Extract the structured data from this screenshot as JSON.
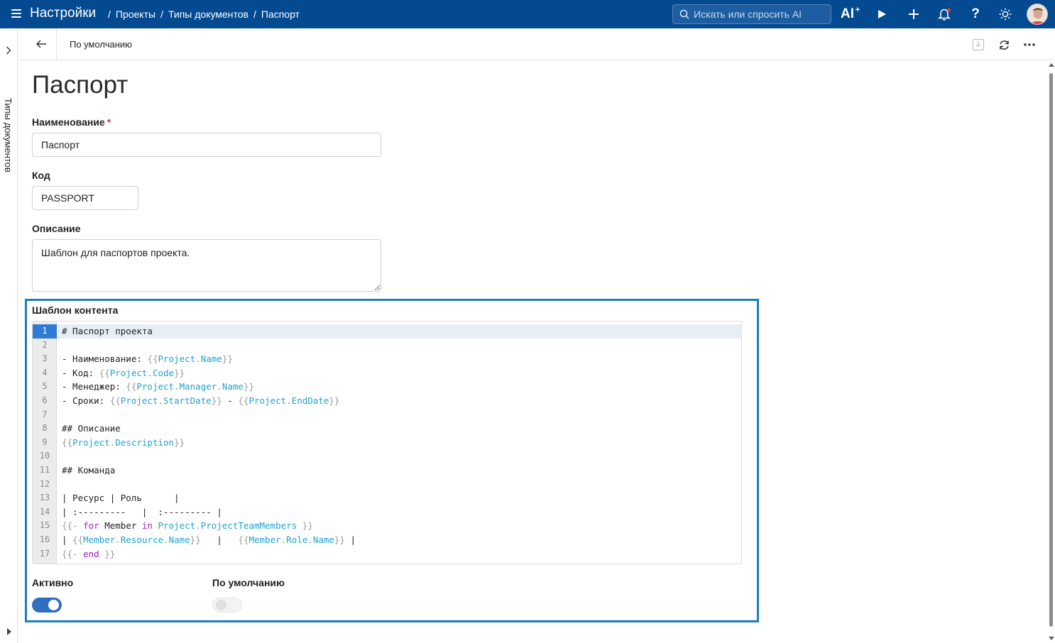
{
  "topbar": {
    "app_title": "Настройки",
    "breadcrumb": [
      "Проекты",
      "Типы документов",
      "Паспорт"
    ],
    "search_placeholder": "Искать или спросить AI",
    "ai_label": "AI",
    "bg_color": "#034a91"
  },
  "left_rail": {
    "label": "Типы документов"
  },
  "subheader": {
    "title": "По умолчанию"
  },
  "page": {
    "title": "Паспорт",
    "fields": {
      "name": {
        "label": "Наименование",
        "required_mark": "*",
        "value": "Паспорт"
      },
      "code": {
        "label": "Код",
        "value": "PASSPORT"
      },
      "description": {
        "label": "Описание",
        "value": "Шаблон для паспортов проекта."
      },
      "template": {
        "label": "Шаблон контента"
      }
    },
    "toggles": {
      "active": {
        "label": "Активно",
        "on": true
      },
      "default": {
        "label": "По умолчанию",
        "on": false
      }
    },
    "highlight_color": "#1b7ebf"
  },
  "editor": {
    "active_line": 1,
    "lines": [
      [
        [
          "plain",
          "# Паспорт проекта"
        ]
      ],
      [],
      [
        [
          "plain",
          "- Наименование: "
        ],
        [
          "brace",
          "{{"
        ],
        [
          "var",
          "Project"
        ],
        [
          "brace",
          "."
        ],
        [
          "var",
          "Name"
        ],
        [
          "brace",
          "}}"
        ]
      ],
      [
        [
          "plain",
          "- Код: "
        ],
        [
          "brace",
          "{{"
        ],
        [
          "var",
          "Project"
        ],
        [
          "brace",
          "."
        ],
        [
          "var",
          "Code"
        ],
        [
          "brace",
          "}}"
        ]
      ],
      [
        [
          "plain",
          "- Менеджер: "
        ],
        [
          "brace",
          "{{"
        ],
        [
          "var",
          "Project"
        ],
        [
          "brace",
          "."
        ],
        [
          "var",
          "Manager"
        ],
        [
          "brace",
          "."
        ],
        [
          "var",
          "Name"
        ],
        [
          "brace",
          "}}"
        ]
      ],
      [
        [
          "plain",
          "- Сроки: "
        ],
        [
          "brace",
          "{{"
        ],
        [
          "var",
          "Project"
        ],
        [
          "brace",
          "."
        ],
        [
          "var",
          "StartDate"
        ],
        [
          "brace",
          "}}"
        ],
        [
          "plain",
          " - "
        ],
        [
          "brace",
          "{{"
        ],
        [
          "var",
          "Project"
        ],
        [
          "brace",
          "."
        ],
        [
          "var",
          "EndDate"
        ],
        [
          "brace",
          "}}"
        ]
      ],
      [],
      [
        [
          "plain",
          "## Описание"
        ]
      ],
      [
        [
          "brace",
          "{{"
        ],
        [
          "var",
          "Project"
        ],
        [
          "brace",
          "."
        ],
        [
          "var",
          "Description"
        ],
        [
          "brace",
          "}}"
        ]
      ],
      [],
      [
        [
          "plain",
          "## Команда"
        ]
      ],
      [],
      [
        [
          "plain",
          "| Ресурс | Роль      |"
        ]
      ],
      [
        [
          "plain",
          "| :---------   |  :--------- |"
        ]
      ],
      [
        [
          "brace",
          "{{- "
        ],
        [
          "kw",
          "for"
        ],
        [
          "plain",
          " Member "
        ],
        [
          "kw",
          "in"
        ],
        [
          "plain",
          " "
        ],
        [
          "var",
          "Project"
        ],
        [
          "brace",
          "."
        ],
        [
          "var",
          "ProjectTeamMembers"
        ],
        [
          "brace",
          " }}"
        ]
      ],
      [
        [
          "plain",
          "| "
        ],
        [
          "brace",
          "{{"
        ],
        [
          "var",
          "Member"
        ],
        [
          "brace",
          "."
        ],
        [
          "var",
          "Resource"
        ],
        [
          "brace",
          "."
        ],
        [
          "var",
          "Name"
        ],
        [
          "brace",
          "}}"
        ],
        [
          "plain",
          "   |   "
        ],
        [
          "brace",
          "{{"
        ],
        [
          "var",
          "Member"
        ],
        [
          "brace",
          "."
        ],
        [
          "var",
          "Role"
        ],
        [
          "brace",
          "."
        ],
        [
          "var",
          "Name"
        ],
        [
          "brace",
          "}}"
        ],
        [
          "plain",
          " |"
        ]
      ],
      [
        [
          "brace",
          "{{- "
        ],
        [
          "kw",
          "end"
        ],
        [
          "brace",
          " }}"
        ]
      ]
    ]
  }
}
